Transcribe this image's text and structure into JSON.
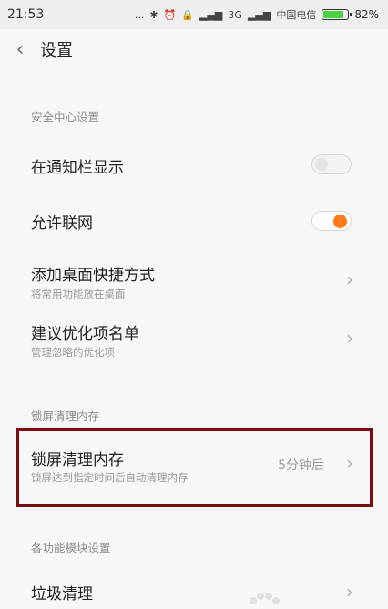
{
  "status_bar": {
    "time": "21:53",
    "dots": "...",
    "network_type": "3G",
    "carrier": "中国电信",
    "battery_percent": "82%",
    "battery_level": 0.82,
    "battery_color": "#4cd140"
  },
  "header": {
    "title": "设置",
    "back_icon": "chevron-left-icon"
  },
  "sections": {
    "security": "安全中心设置",
    "lock_clean": "锁屏清理内存",
    "modules": "各功能模块设置"
  },
  "rows": {
    "notify": {
      "label": "在通知栏显示",
      "toggle": false
    },
    "network": {
      "label": "允许联网",
      "toggle": true,
      "accent": "#ff7a19"
    },
    "shortcut": {
      "label": "添加桌面快捷方式",
      "sub": "将常用功能放在桌面"
    },
    "optimize": {
      "label": "建议优化项名单",
      "sub": "管理忽略的优化项"
    },
    "lock_clean": {
      "label": "锁屏清理内存",
      "sub": "锁屏达到指定时间后自动清理内存",
      "value": "5分钟后"
    },
    "garbage": {
      "label": "垃圾清理"
    }
  },
  "highlight_color": "#7a0e12"
}
